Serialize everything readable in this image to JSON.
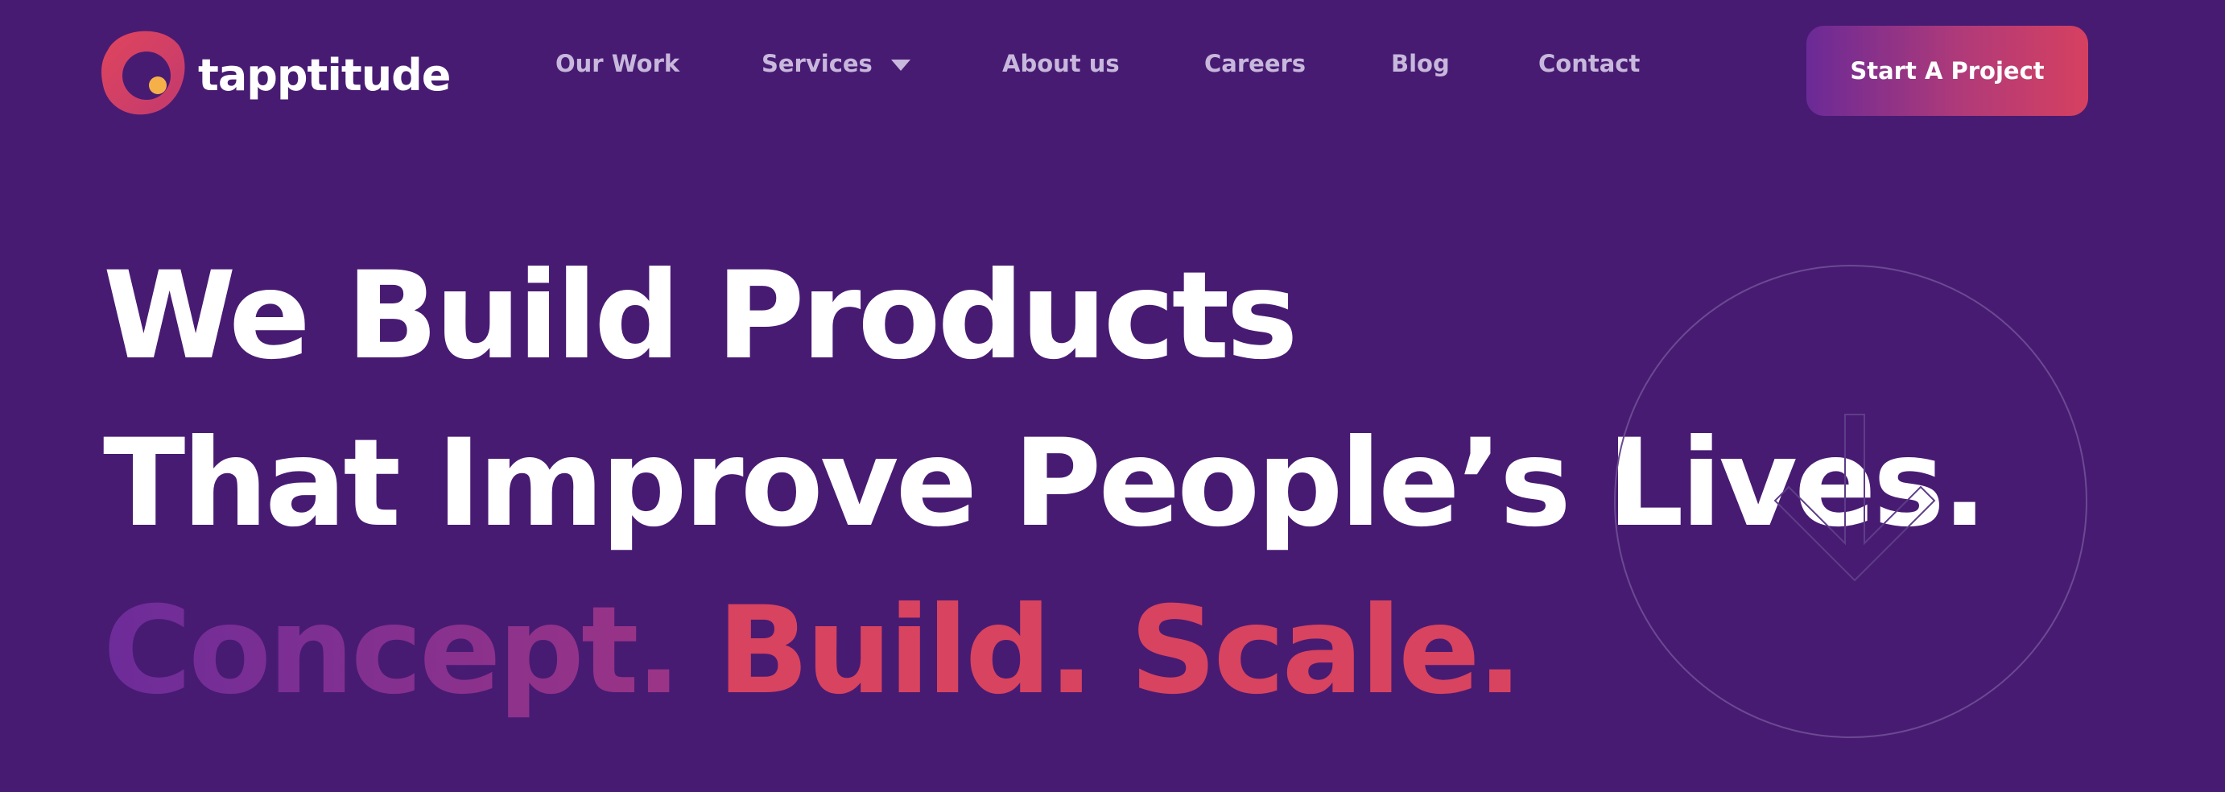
{
  "brand": {
    "name": "tapptitude",
    "logo_icon": "tapptitude-logo-icon"
  },
  "nav": {
    "items": [
      {
        "label": "Our Work"
      },
      {
        "label": "Services",
        "icon": "chevron-down-icon"
      },
      {
        "label": "About us"
      },
      {
        "label": "Careers"
      },
      {
        "label": "Blog"
      },
      {
        "label": "Contact"
      }
    ],
    "cta_label": "Start A Project"
  },
  "hero": {
    "line1": "We Build Products",
    "line2": "That Improve People’s Lives.",
    "line3": {
      "word1": "Concept.",
      "word2": "Build.",
      "word3": "Scale."
    },
    "scroll_icon": "arrow-down-icon"
  },
  "colors": {
    "background": "#481b73",
    "accent_red": "#d8435f",
    "accent_purple": "#6d2c9a",
    "nav_text": "#c7b8dc",
    "logo_yellow": "#f5b04a"
  }
}
